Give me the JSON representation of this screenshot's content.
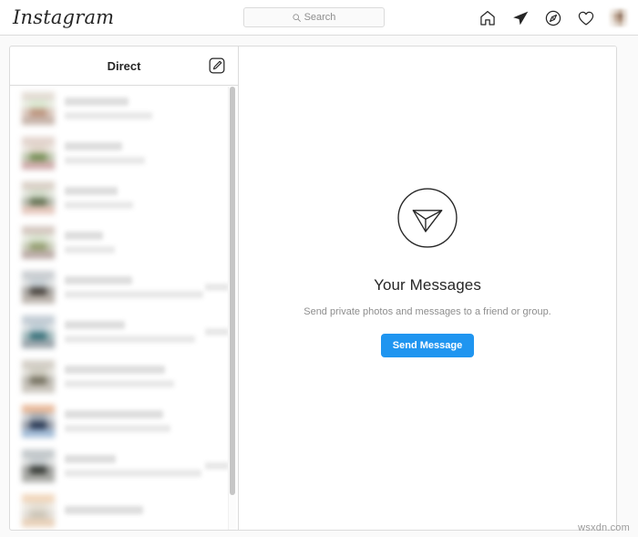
{
  "nav": {
    "brand": "Instagram",
    "search": {
      "placeholder": "Search",
      "icon": "search-icon"
    },
    "icons": [
      {
        "name": "home-icon",
        "label": "Home",
        "active": false
      },
      {
        "name": "direct-paper-plane-icon",
        "label": "Direct",
        "active": true
      },
      {
        "name": "explore-compass-icon",
        "label": "Explore",
        "active": false
      },
      {
        "name": "activity-heart-icon",
        "label": "Activity",
        "active": false
      }
    ],
    "avatar": {
      "name": "profile-avatar",
      "redacted": true,
      "colors": [
        "#e8e2dc",
        "#c7b6a8",
        "#8d6f5c",
        "#d8cbc0"
      ]
    }
  },
  "inbox": {
    "title": "Direct",
    "new_message_icon": "new-message-compose-icon",
    "scrollbar": {
      "visible": true,
      "thumb_position": "top"
    },
    "threads": [
      {
        "redacted": true,
        "avatar_colors": [
          "#cbbba8",
          "#8a5f4a",
          "#b98f78",
          "#d9e8cf"
        ],
        "name_width": 70,
        "has_preview": true,
        "preview_width": 96,
        "has_time": false
      },
      {
        "redacted": true,
        "avatar_colors": [
          "#c9a99c",
          "#9c4a4a",
          "#6f8a4e",
          "#ded3c6"
        ],
        "name_width": 63,
        "has_preview": true,
        "preview_width": 88,
        "has_time": false
      },
      {
        "redacted": true,
        "avatar_colors": [
          "#b6a08c",
          "#d08a72",
          "#5d6b4b",
          "#cfd9c6"
        ],
        "name_width": 58,
        "has_preview": true,
        "preview_width": 75,
        "has_time": false
      },
      {
        "redacted": true,
        "avatar_colors": [
          "#a98d7c",
          "#6d4a40",
          "#8f9a6a",
          "#d7e2cc"
        ],
        "name_width": 42,
        "has_preview": true,
        "preview_width": 55,
        "has_time": false
      },
      {
        "redacted": true,
        "avatar_colors": [
          "#8e9aa4",
          "#6b5a4c",
          "#3f3a34",
          "#c3ccd2"
        ],
        "name_width": 74,
        "has_preview": true,
        "preview_width": 152,
        "has_time": true
      },
      {
        "redacted": true,
        "avatar_colors": [
          "#7f98ad",
          "#1e3a4c",
          "#2f6b74",
          "#b9c9d2"
        ],
        "name_width": 66,
        "has_preview": true,
        "preview_width": 143,
        "has_time": true
      },
      {
        "redacted": true,
        "avatar_colors": [
          "#a59c8a",
          "#8d8674",
          "#6f6a58",
          "#cbc8bb"
        ],
        "name_width": 110,
        "has_preview": true,
        "preview_width": 120,
        "has_time": false
      },
      {
        "redacted": true,
        "avatar_colors": [
          "#d96a22",
          "#2f6fb5",
          "#1d2d4a",
          "#9aa3ad"
        ],
        "name_width": 108,
        "has_preview": true,
        "preview_width": 116,
        "has_time": false
      },
      {
        "redacted": true,
        "avatar_colors": [
          "#7d8b96",
          "#3b4038",
          "#2b2f2a",
          "#c2c8cb"
        ],
        "name_width": 56,
        "has_preview": true,
        "preview_width": 150,
        "has_time": true
      },
      {
        "redacted": true,
        "avatar_colors": [
          "#edb071",
          "#d9a26a",
          "#c9c2b4",
          "#e4ded2"
        ],
        "name_width": 86,
        "has_preview": false,
        "preview_width": 0,
        "has_time": false
      }
    ]
  },
  "empty_state": {
    "icon": "paper-plane-circle-icon",
    "title": "Your Messages",
    "subtitle": "Send private photos and messages to a friend or group.",
    "button_label": "Send Message",
    "button_color": "#1f95f0"
  },
  "watermark": {
    "text": "wsxdn.com"
  }
}
